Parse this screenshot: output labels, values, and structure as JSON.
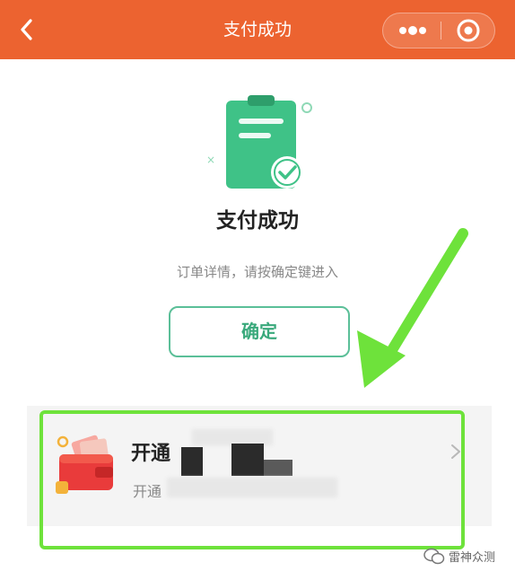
{
  "header": {
    "title": "支付成功",
    "background": "#ec6330",
    "back_icon": "chevron-left-icon",
    "more_icon": "more-dots-icon",
    "close_icon": "target-circle-icon"
  },
  "main": {
    "illustration_icon": "clipboard-check-icon",
    "title": "支付成功",
    "subtitle": "订单详情，请按确定键进入",
    "confirm_label": "确定",
    "accent_color": "#3aa97c"
  },
  "card": {
    "icon": "wallet-icon",
    "title": "开通",
    "subtitle": "开通",
    "chevron_icon": "chevron-right-icon",
    "highlight_color": "#6ee23b"
  },
  "annotation": {
    "arrow_icon": "green-arrow-icon",
    "arrow_color": "#6ee23b"
  },
  "watermark": {
    "icon": "wechat-icon",
    "text": "雷神众测"
  }
}
